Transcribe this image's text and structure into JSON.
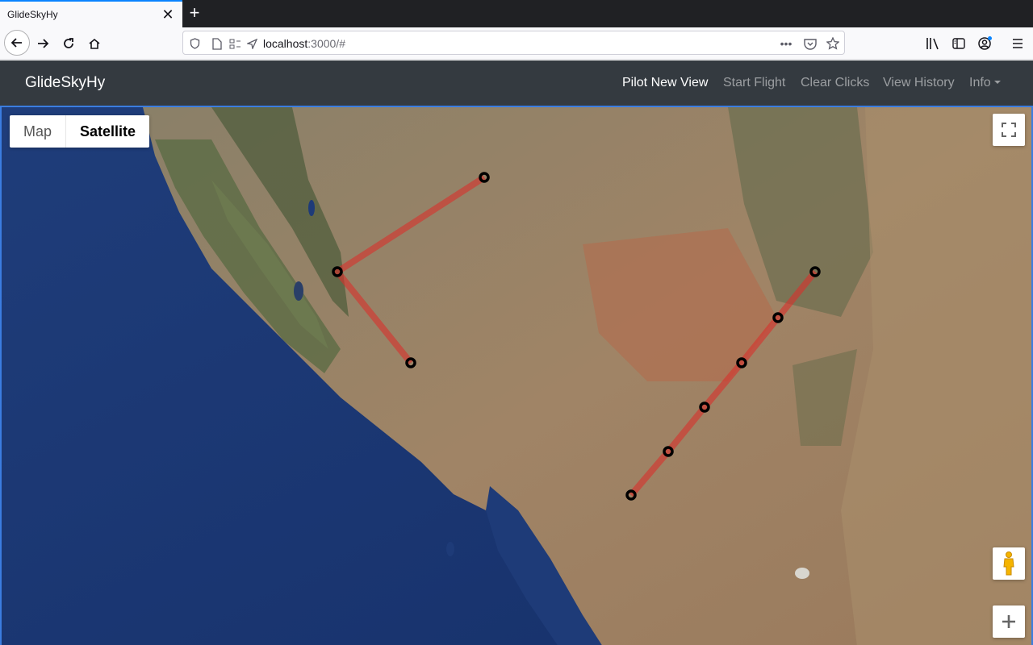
{
  "browser": {
    "tab_title": "GlideSkyHy",
    "url_host": "localhost",
    "url_path": ":3000/#"
  },
  "navbar": {
    "brand": "GlideSkyHy",
    "links": [
      "Pilot New View",
      "Start Flight",
      "Clear Clicks",
      "View History",
      "Info"
    ],
    "active": "Pilot New View"
  },
  "map": {
    "type_options": [
      "Map",
      "Satellite"
    ],
    "selected_type": "Satellite",
    "path_color": "#d9302c",
    "marker_color": "#000000"
  },
  "icons": {
    "back": "back-arrow-icon",
    "forward": "forward-arrow-icon",
    "reload": "reload-icon",
    "home": "home-icon",
    "fullscreen": "fullscreen-icon",
    "pegman": "pegman-icon",
    "zoom_in": "plus-icon"
  }
}
